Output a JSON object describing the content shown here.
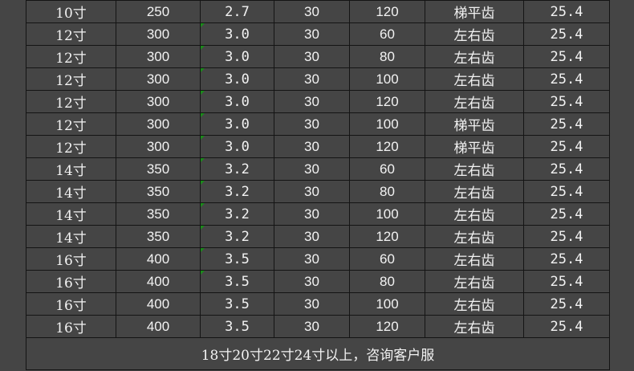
{
  "rows": [
    [
      "10寸",
      "250",
      "2.7",
      "30",
      "120",
      "梯平齿",
      "25.4"
    ],
    [
      "12寸",
      "300",
      "3.0",
      "30",
      "60",
      "左右齿",
      "25.4"
    ],
    [
      "12寸",
      "300",
      "3.0",
      "30",
      "80",
      "左右齿",
      "25.4"
    ],
    [
      "12寸",
      "300",
      "3.0",
      "30",
      "100",
      "左右齿",
      "25.4"
    ],
    [
      "12寸",
      "300",
      "3.0",
      "30",
      "120",
      "左右齿",
      "25.4"
    ],
    [
      "12寸",
      "300",
      "3.0",
      "30",
      "100",
      "梯平齿",
      "25.4"
    ],
    [
      "12寸",
      "300",
      "3.0",
      "30",
      "120",
      "梯平齿",
      "25.4"
    ],
    [
      "14寸",
      "350",
      "3.2",
      "30",
      "60",
      "左右齿",
      "25.4"
    ],
    [
      "14寸",
      "350",
      "3.2",
      "30",
      "80",
      "左右齿",
      "25.4"
    ],
    [
      "14寸",
      "350",
      "3.2",
      "30",
      "100",
      "左右齿",
      "25.4"
    ],
    [
      "14寸",
      "350",
      "3.2",
      "30",
      "120",
      "左右齿",
      "25.4"
    ],
    [
      "16寸",
      "400",
      "3.5",
      "30",
      "60",
      "左右齿",
      "25.4"
    ],
    [
      "16寸",
      "400",
      "3.5",
      "30",
      "80",
      "左右齿",
      "25.4"
    ],
    [
      "16寸",
      "400",
      "3.5",
      "30",
      "100",
      "左右齿",
      "25.4"
    ],
    [
      "16寸",
      "400",
      "3.5",
      "30",
      "120",
      "左右齿",
      "25.4"
    ]
  ],
  "footer_note": "18寸20寸22寸24寸以上，咨询客户服",
  "colors": {
    "background": "#454545",
    "text": "#f2f2f2",
    "border": "#141414",
    "corner_mark": "#1a8c1a"
  }
}
